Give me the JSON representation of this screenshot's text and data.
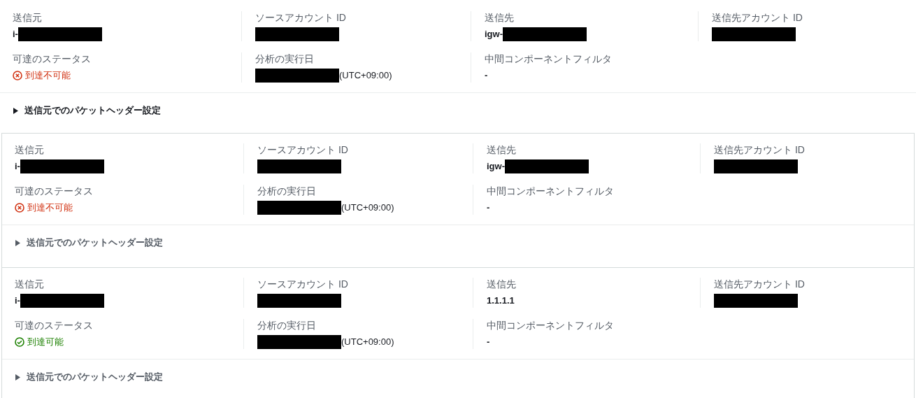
{
  "analyses": [
    {
      "framed": false,
      "fields": [
        {
          "label": "送信元",
          "value": {
            "text": "i-",
            "redacted": true
          }
        },
        {
          "label": "ソースアカウント ID",
          "value": {
            "redacted": true
          }
        },
        {
          "label": "送信先",
          "value": {
            "text": "igw-",
            "redacted": true
          }
        },
        {
          "label": "送信先アカウント ID",
          "value": {
            "redacted": true
          }
        },
        {
          "label": "可達のステータス",
          "status": {
            "text": "到達不可能",
            "reachable": false
          }
        },
        {
          "label": "分析の実行日",
          "value": {
            "redacted": true,
            "suffix": "(UTC+09:00)"
          }
        },
        {
          "label": "中間コンポーネントフィルタ",
          "value": {
            "text": "-"
          }
        }
      ],
      "expander": {
        "label": "送信元でのパケットヘッダー設定",
        "expanded": false
      }
    },
    {
      "framed": true,
      "fields": [
        {
          "label": "送信元",
          "value": {
            "text": "i-",
            "redacted": true
          }
        },
        {
          "label": "ソースアカウント ID",
          "value": {
            "redacted": true
          }
        },
        {
          "label": "送信先",
          "value": {
            "text": "igw-",
            "redacted": true
          }
        },
        {
          "label": "送信先アカウント ID",
          "value": {
            "redacted": true
          }
        },
        {
          "label": "可達のステータス",
          "status": {
            "text": "到達不可能",
            "reachable": false
          }
        },
        {
          "label": "分析の実行日",
          "value": {
            "redacted": true,
            "suffix": "(UTC+09:00)"
          }
        },
        {
          "label": "中間コンポーネントフィルタ",
          "value": {
            "text": "-"
          }
        }
      ],
      "expander": {
        "label": "送信元でのパケットヘッダー設定",
        "expanded": false
      }
    },
    {
      "framed": true,
      "fields": [
        {
          "label": "送信元",
          "value": {
            "text": "i-",
            "redacted": true
          }
        },
        {
          "label": "ソースアカウント ID",
          "value": {
            "redacted": true
          }
        },
        {
          "label": "送信先",
          "value": {
            "text": "1.1.1.1"
          }
        },
        {
          "label": "送信先アカウント ID",
          "value": {
            "redacted": true
          }
        },
        {
          "label": "可達のステータス",
          "status": {
            "text": "到達可能",
            "reachable": true
          }
        },
        {
          "label": "分析の実行日",
          "value": {
            "redacted": true,
            "suffix": "(UTC+09:00)"
          }
        },
        {
          "label": "中間コンポーネントフィルタ",
          "value": {
            "text": "-"
          }
        }
      ],
      "expander": {
        "label": "送信元でのパケットヘッダー設定",
        "expanded": false
      }
    }
  ]
}
